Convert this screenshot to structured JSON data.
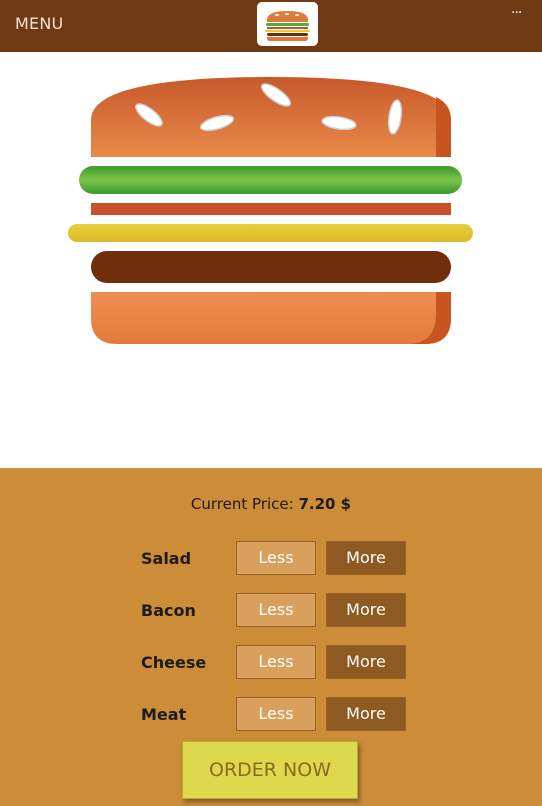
{
  "header": {
    "menu_label": "MENU",
    "more_label": "..."
  },
  "burger": {
    "layers": [
      "top-bun",
      "salad",
      "bacon",
      "cheese",
      "meat",
      "bottom-bun"
    ]
  },
  "price": {
    "label": "Current Price:",
    "value": "7.20 $"
  },
  "ingredients": [
    {
      "name": "Salad",
      "less_label": "Less",
      "more_label": "More"
    },
    {
      "name": "Bacon",
      "less_label": "Less",
      "more_label": "More"
    },
    {
      "name": "Cheese",
      "less_label": "Less",
      "more_label": "More"
    },
    {
      "name": "Meat",
      "less_label": "Less",
      "more_label": "More"
    }
  ],
  "order_button": {
    "label": "ORDER NOW"
  },
  "colors": {
    "header_bg": "#6f3914",
    "controls_bg": "#cd8c37",
    "bun": "#e07a3a",
    "salad": "#4caf3c",
    "bacon": "#c8502a",
    "cheese": "#e6c832",
    "meat": "#6e2e0c",
    "order_button_bg": "#ddd84c"
  }
}
